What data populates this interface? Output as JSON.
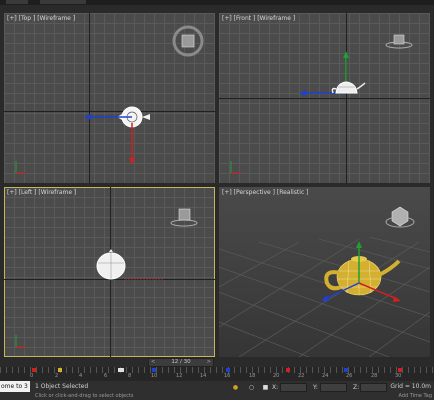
{
  "viewports": {
    "top": {
      "label": "[+] [Top ] [Wireframe ]"
    },
    "front": {
      "label": "[+] [Front ] [Wireframe ]"
    },
    "left": {
      "label": "[+] [Left ] [Wireframe ]"
    },
    "perspective": {
      "label": "[+] [Perspective ] [Realistic ]"
    }
  },
  "time_slider": {
    "label": "12 / 30",
    "prev": "<",
    "next": ">"
  },
  "trackbar": {
    "ticks": [
      "0",
      "2",
      "4",
      "6",
      "8",
      "10",
      "12",
      "14",
      "16",
      "18",
      "20",
      "22",
      "24",
      "26",
      "28",
      "30"
    ]
  },
  "status": {
    "welcome": "ome to 3",
    "selection": "1 Object Selected",
    "prompt": "Click or click-and-drag to select objects",
    "x_label": "X:",
    "y_label": "Y:",
    "z_label": "Z:",
    "grid": "Grid = 10.0m",
    "add_time_tag": "Add Time Tag"
  },
  "colors": {
    "accent_active_border": "#c8b45a",
    "axis_x": "#2040d0",
    "axis_y": "#20a030",
    "axis_z": "#d02020",
    "teapot_realistic": "#d4b030"
  }
}
